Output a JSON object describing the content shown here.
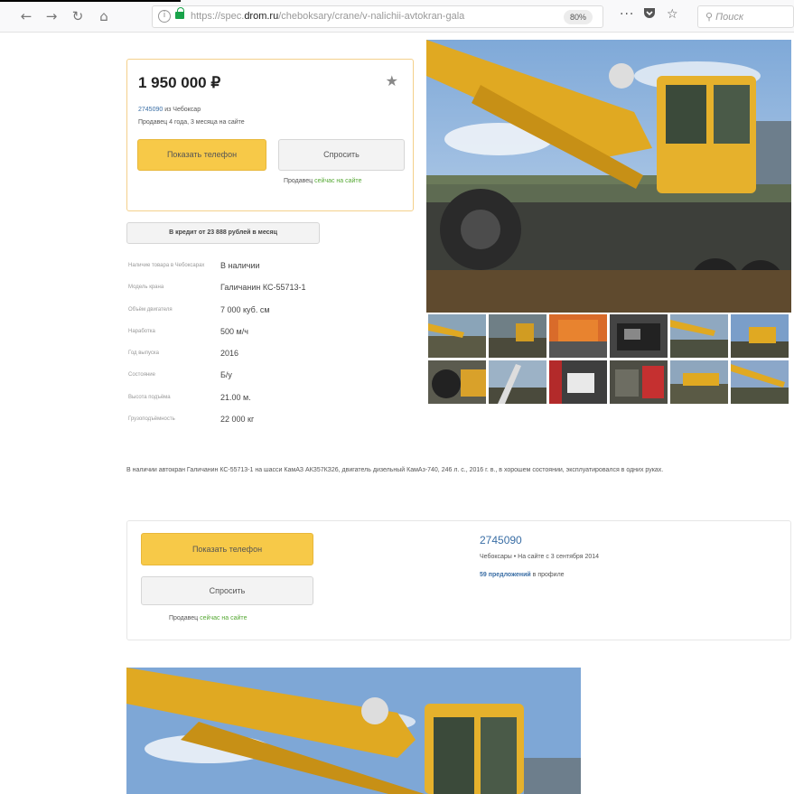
{
  "browser": {
    "back_icon": "arrow-left-icon",
    "forward_icon": "arrow-right-icon",
    "reload_icon": "reload-icon",
    "home_icon": "home-icon",
    "url_prefix": "https://spec.",
    "url_domain": "drom.ru",
    "url_path": "/cheboksary/crane/v-nalichii-avtokran-gala",
    "zoom": "80%",
    "menu_glyph": "···",
    "search_placeholder": "Поиск"
  },
  "listing": {
    "price": "1 950 000 ₽",
    "seller_id": "2745090",
    "seller_city": " из Чебоксар",
    "since": "Продавец 4 года, 3 месяца на сайте",
    "show_phone": "Показать телефон",
    "ask": "Спросить",
    "online_prefix": "Продавец ",
    "online_status": "сейчас на сайте",
    "credit": "В кредит от 23 888 рублей в месяц"
  },
  "specs": [
    {
      "label": "Наличие товара в Чебоксарах",
      "value": "В наличии"
    },
    {
      "label": "Модель крана",
      "value": "Галичанин КС-55713-1"
    },
    {
      "label": "Объём двигателя",
      "value": "7 000 куб. см"
    },
    {
      "label": "Наработка",
      "value": "500 м/ч"
    },
    {
      "label": "Год выпуска",
      "value": "2016"
    },
    {
      "label": "Состояние",
      "value": "Б/у"
    },
    {
      "label": "Высота подъёма",
      "value": "21.00 м."
    },
    {
      "label": "Грузоподъёмность",
      "value": "22 000 кг"
    }
  ],
  "description": "В наличии автокран Галичанин КС-55713-1 на шасси КамАЗ АКЗ57КЗ26, двигатель дизельный КамАз-740, 246 л. с., 2016 г. в., в хорошем состоянии, эксплуатировался в одних руках.",
  "contact": {
    "show_phone": "Показать телефон",
    "ask": "Спросить",
    "online_prefix": "Продавец ",
    "online_status": "сейчас на сайте",
    "seller_id": "2745090",
    "location": "Чебоксары  •  На сайте с 3 сентября 2014",
    "offers_link": "59 предложений",
    "offers_suffix": " в профиле"
  },
  "colors": {
    "accent_yellow": "#f7c948",
    "link_blue": "#3a6ea5",
    "online_green": "#55a833"
  }
}
